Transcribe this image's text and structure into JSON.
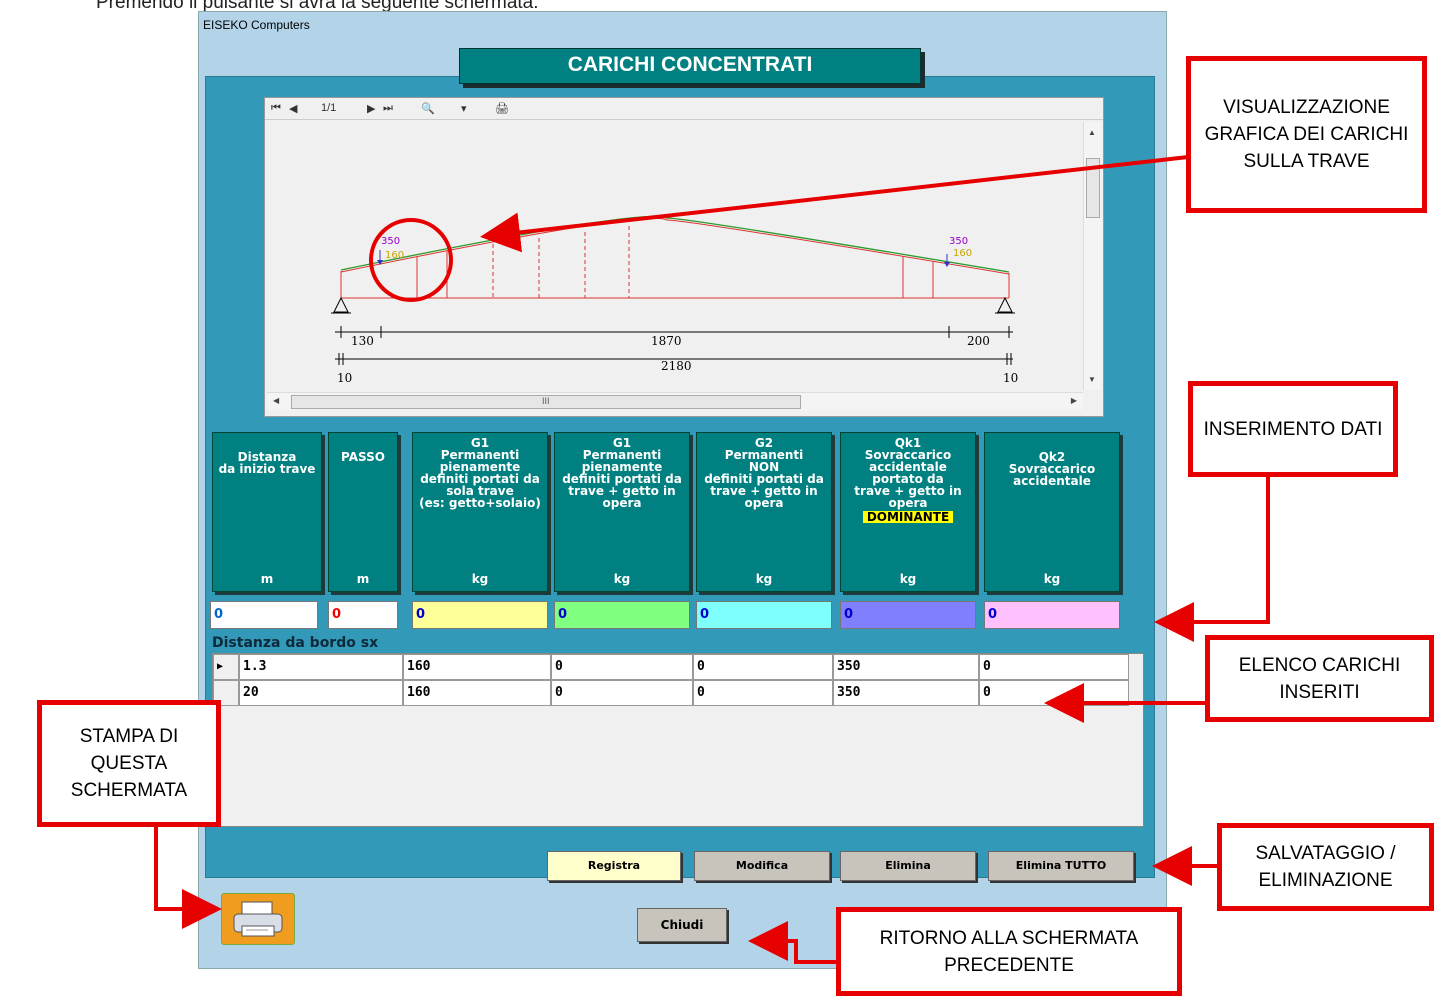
{
  "page_top_text": "Premendo il pulsante si avrà la seguente schermata:",
  "window": {
    "title": "EISEKO Computers",
    "banner": "CARICHI CONCENTRATI"
  },
  "preview": {
    "toolbar": {
      "first": "⏮",
      "prev": "◀",
      "page": "1/1",
      "next": "▶",
      "last": "⏭",
      "zoom": "🔍",
      "dropdown": "▾",
      "print": "🖨"
    },
    "drawing": {
      "load_left_q": "350",
      "load_left_g": "160",
      "load_right_q": "350",
      "load_right_g": "160",
      "dim_left": "130",
      "dim_mid": "1870",
      "dim_right": "200",
      "dim_total": "2180",
      "support_left": "10",
      "support_right": "10"
    },
    "hscroll_label": "III"
  },
  "headers": [
    {
      "title": "Distanza\nda inizio trave",
      "unit": "m"
    },
    {
      "title": "PASSO",
      "unit": "m"
    },
    {
      "title": "G1\nPermanenti\npienamente\ndefiniti portati da\nsola trave\n(es: getto+solaio)",
      "unit": "kg"
    },
    {
      "title": "G1\nPermanenti\npienamente\ndefiniti portati da\ntrave + getto in\nopera",
      "unit": "kg"
    },
    {
      "title": "G2\nPermanenti\nNON\ndefiniti portati da\ntrave + getto in\nopera",
      "unit": "kg"
    },
    {
      "title": "Qk1\nSovraccarico\naccidentale\nportato da\ntrave + getto in\nopera",
      "badge": "DOMINANTE",
      "unit": "kg"
    },
    {
      "title": "Qk2\nSovraccarico\naccidentale",
      "unit": "kg"
    }
  ],
  "inputs": [
    "0",
    "0",
    "0",
    "0",
    "0",
    "0",
    "0"
  ],
  "sub_label": "Distanza da bordo sx",
  "rows": [
    {
      "marker": "▶",
      "cells": [
        "1.3",
        "160",
        "0",
        "0",
        "350",
        "0"
      ]
    },
    {
      "marker": "",
      "cells": [
        "20",
        "160",
        "0",
        "0",
        "350",
        "0"
      ]
    }
  ],
  "buttons": {
    "registra": "Registra",
    "modifica": "Modifica",
    "elimina": "Elimina",
    "elimina_tutto": "Elimina TUTTO",
    "chiudi": "Chiudi"
  },
  "callouts": {
    "grafica": "VISUALIZZAZIONE GRAFICA DEI CARICHI SULLA TRAVE",
    "inserimento": "INSERIMENTO DATI",
    "elenco": "ELENCO CARICHI INSERITI",
    "salvataggio": "SALVATAGGIO / ELIMINAZIONE",
    "stampa": "STAMPA DI QUESTA SCHERMATA",
    "ritorno": "RITORNO ALLA SCHERMATA PRECEDENTE"
  },
  "colors": {
    "teal": "#008080",
    "panel": "#3399b8",
    "callout_red": "#e60000",
    "input_yellow": "#ffff99",
    "input_green": "#80ff80",
    "input_cyan": "#80ffff",
    "input_blue": "#8080ff",
    "input_pink": "#ffc0ff"
  }
}
